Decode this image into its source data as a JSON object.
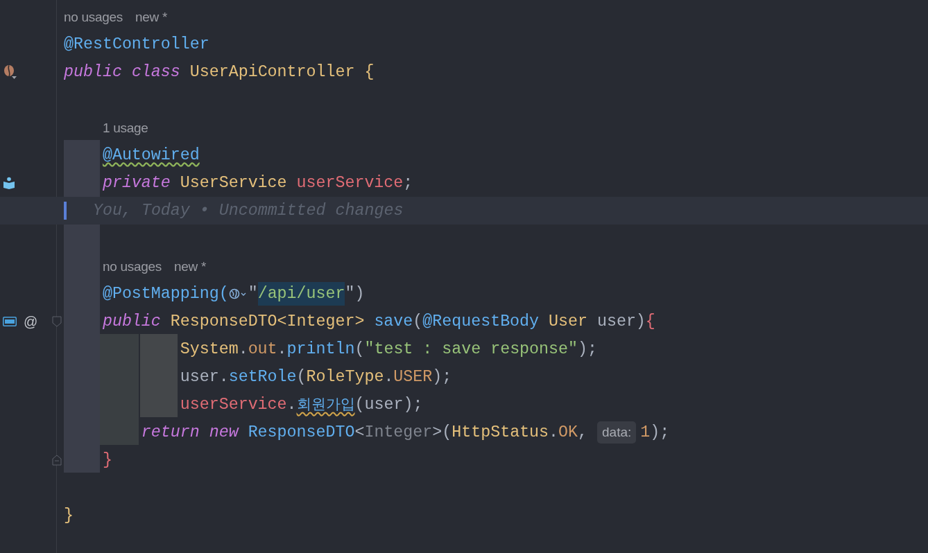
{
  "editor": {
    "lines": [
      {
        "kind": "hint",
        "indented": false,
        "hints": [
          "no usages",
          "new *"
        ]
      },
      {
        "kind": "code",
        "tokens": [
          {
            "kind": "annotation",
            "text": "@RestController"
          }
        ]
      },
      {
        "kind": "code",
        "gutter": [
          {
            "kind": "bean"
          }
        ],
        "tokens": [
          {
            "kind": "keyword",
            "text": "public "
          },
          {
            "kind": "keyword",
            "text": "class "
          },
          {
            "kind": "type_name",
            "text": "UserApiController "
          },
          {
            "kind": "bracket_gold",
            "text": "{"
          }
        ]
      },
      {
        "kind": "blank"
      },
      {
        "kind": "hint",
        "indented": true,
        "hints": [
          "1 usage"
        ]
      },
      {
        "kind": "code",
        "tokens": [
          {
            "kind": "annotation_weak_warning",
            "text": "    @Autowired"
          }
        ]
      },
      {
        "kind": "code",
        "gutter": [
          {
            "kind": "injected_bean"
          }
        ],
        "tokens": [
          {
            "kind": "keyword",
            "text": "    private "
          },
          {
            "kind": "type_name",
            "text": "UserService "
          },
          {
            "kind": "field",
            "text": "userService"
          },
          {
            "kind": "plain",
            "text": ";"
          }
        ]
      },
      {
        "kind": "blame",
        "text": "You, Today • Uncommitted changes"
      },
      {
        "kind": "blank"
      },
      {
        "kind": "hint",
        "indented": true,
        "hints": [
          "no usages",
          "new *"
        ]
      },
      {
        "kind": "code",
        "tokens": [
          {
            "kind": "annotation",
            "text": "    @PostMapping("
          },
          {
            "kind": "globe_icon"
          },
          {
            "kind": "plain",
            "text": "\""
          },
          {
            "kind": "url",
            "text": "/api/user"
          },
          {
            "kind": "plain",
            "text": "\")"
          }
        ]
      },
      {
        "kind": "code",
        "gutter": [
          {
            "kind": "api"
          },
          {
            "kind": "text",
            "text": "@"
          },
          {
            "kind": "fold_start"
          }
        ],
        "tokens": [
          {
            "kind": "keyword",
            "text": "    public "
          },
          {
            "kind": "type_name",
            "text": "ResponseDTO<Integer> "
          },
          {
            "kind": "method",
            "text": "save"
          },
          {
            "kind": "plain",
            "text": "("
          },
          {
            "kind": "annotation",
            "text": "@RequestBody "
          },
          {
            "kind": "type_name",
            "text": "User "
          },
          {
            "kind": "plain",
            "text": "user)"
          },
          {
            "kind": "bracket_red",
            "text": "{"
          }
        ]
      },
      {
        "kind": "code",
        "tokens": [
          {
            "kind": "type_name",
            "text": "            System"
          },
          {
            "kind": "plain",
            "text": "."
          },
          {
            "kind": "constant",
            "text": "out"
          },
          {
            "kind": "plain",
            "text": "."
          },
          {
            "kind": "method",
            "text": "println"
          },
          {
            "kind": "plain",
            "text": "("
          },
          {
            "kind": "string",
            "text": "\"test : save response\""
          },
          {
            "kind": "plain",
            "text": ");"
          }
        ]
      },
      {
        "kind": "code",
        "tokens": [
          {
            "kind": "plain",
            "text": "            user."
          },
          {
            "kind": "method",
            "text": "setRole"
          },
          {
            "kind": "plain",
            "text": "("
          },
          {
            "kind": "type_name",
            "text": "RoleType"
          },
          {
            "kind": "plain",
            "text": "."
          },
          {
            "kind": "constant",
            "text": "USER"
          },
          {
            "kind": "plain",
            "text": ");"
          }
        ]
      },
      {
        "kind": "code",
        "tokens": [
          {
            "kind": "field",
            "text": "            userService"
          },
          {
            "kind": "plain",
            "text": "."
          },
          {
            "kind": "method_korean_typo",
            "text": "회원가입"
          },
          {
            "kind": "plain",
            "text": "(user);"
          }
        ]
      },
      {
        "kind": "code",
        "tokens": [
          {
            "kind": "keyword",
            "text": "        return "
          },
          {
            "kind": "keyword",
            "text": "new "
          },
          {
            "kind": "method",
            "text": "ResponseDTO"
          },
          {
            "kind": "plain",
            "text": "<"
          },
          {
            "kind": "muted",
            "text": "Integer"
          },
          {
            "kind": "plain",
            "text": ">("
          },
          {
            "kind": "type_name",
            "text": "HttpStatus"
          },
          {
            "kind": "plain",
            "text": "."
          },
          {
            "kind": "constant",
            "text": "OK"
          },
          {
            "kind": "plain",
            "text": ", "
          },
          {
            "kind": "inlay",
            "text": "data:"
          },
          {
            "kind": "constant",
            "text": "1"
          },
          {
            "kind": "plain",
            "text": ");"
          }
        ]
      },
      {
        "kind": "code",
        "gutter": [
          {
            "kind": "fold_end"
          }
        ],
        "tokens": [
          {
            "kind": "bracket_red",
            "text": "    }"
          }
        ]
      },
      {
        "kind": "blank"
      },
      {
        "kind": "code",
        "tokens": [
          {
            "kind": "bracket_gold",
            "text": "}"
          }
        ]
      }
    ]
  }
}
